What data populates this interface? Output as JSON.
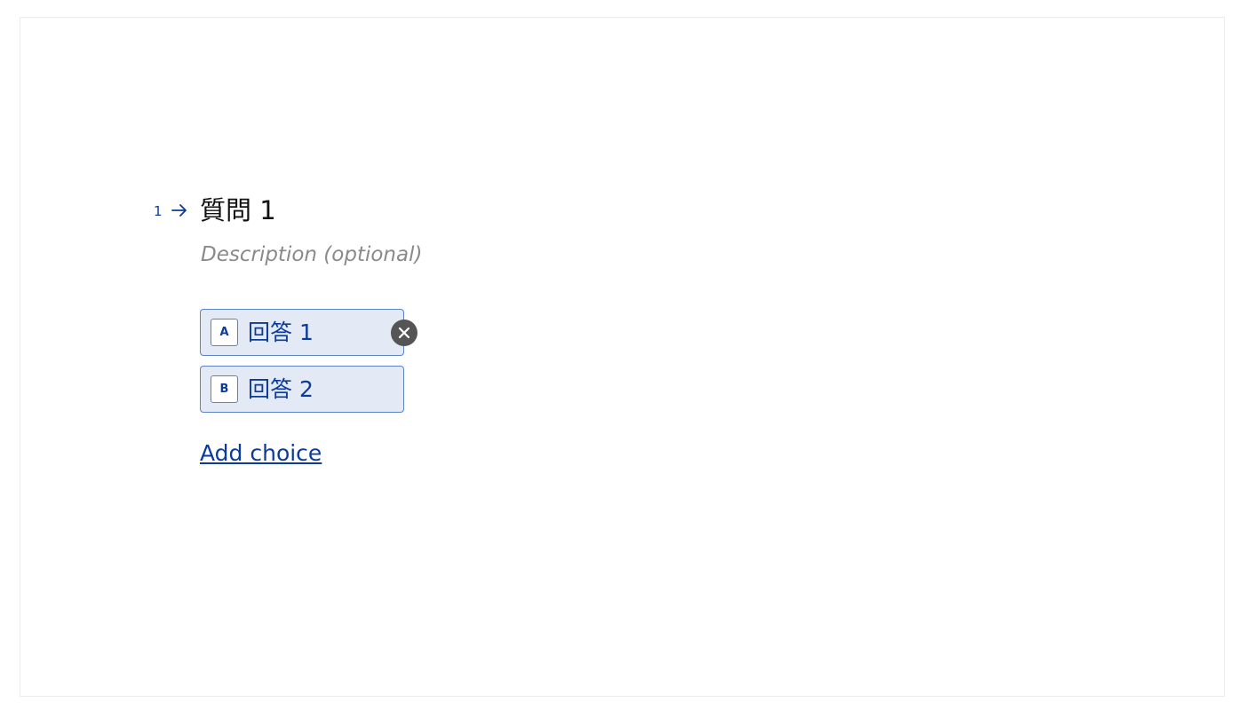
{
  "question": {
    "number": "1",
    "title": "質問 1",
    "description_placeholder": "Description (optional)"
  },
  "choices": [
    {
      "key": "A",
      "label": "回答 1"
    },
    {
      "key": "B",
      "label": "回答 2"
    }
  ],
  "actions": {
    "add_choice_label": "Add choice"
  },
  "icons": {
    "number_arrow": "arrow-right-icon",
    "remove_choice": "close-icon"
  },
  "colors": {
    "accent": "#0b3b9c",
    "choice_background": "#e3e9f5",
    "choice_border": "#5d83c7",
    "remove_button": "#555555",
    "placeholder_text": "#8a8a8a"
  }
}
